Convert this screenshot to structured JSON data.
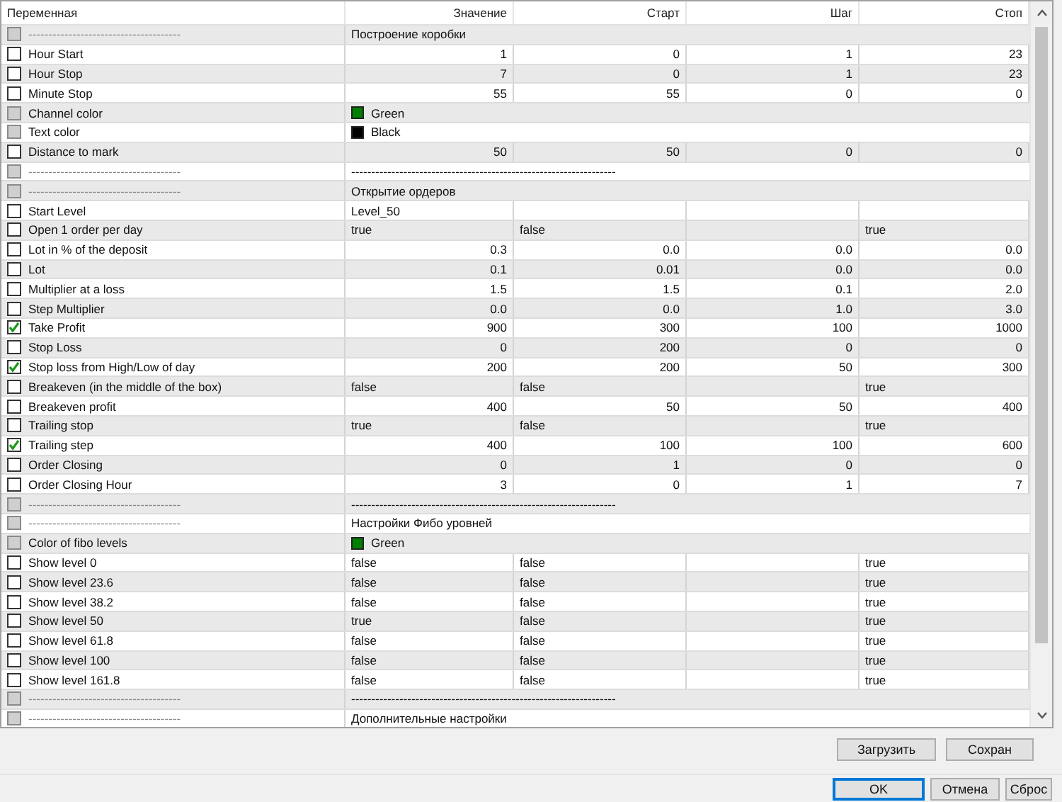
{
  "table": {
    "columns": [
      "Переменная",
      "Значение",
      "Старт",
      "Шаг",
      "Стоп"
    ],
    "rows": [
      {
        "kind": "section",
        "name": "--------------------------------------",
        "checked": false,
        "disabled": true,
        "value": "Построение коробки"
      },
      {
        "kind": "number",
        "name": "Hour Start",
        "checked": false,
        "disabled": false,
        "value": "1",
        "start": "0",
        "step": "1",
        "stop": "23"
      },
      {
        "kind": "number",
        "name": "Hour Stop",
        "checked": false,
        "disabled": false,
        "value": "7",
        "start": "0",
        "step": "1",
        "stop": "23"
      },
      {
        "kind": "number",
        "name": "Minute Stop",
        "checked": false,
        "disabled": false,
        "value": "55",
        "start": "55",
        "step": "0",
        "stop": "0"
      },
      {
        "kind": "color",
        "name": "Channel color",
        "checked": false,
        "disabled": true,
        "value": "Green",
        "color": "#008000"
      },
      {
        "kind": "color",
        "name": "Text color",
        "checked": false,
        "disabled": true,
        "value": "Black",
        "color": "#000000"
      },
      {
        "kind": "number",
        "name": "Distance to mark",
        "checked": false,
        "disabled": false,
        "value": "50",
        "start": "50",
        "step": "0",
        "stop": "0"
      },
      {
        "kind": "section",
        "name": "--------------------------------------",
        "checked": false,
        "disabled": true,
        "value": "------------------------------------------------------------------"
      },
      {
        "kind": "section",
        "name": "--------------------------------------",
        "checked": false,
        "disabled": true,
        "value": "Открытие ордеров"
      },
      {
        "kind": "text",
        "name": "Start Level",
        "checked": false,
        "disabled": false,
        "value": "Level_50"
      },
      {
        "kind": "bool",
        "name": "Open 1 order per day",
        "checked": false,
        "disabled": false,
        "value": "true",
        "start": "false",
        "stop": "true"
      },
      {
        "kind": "number",
        "name": "Lot in % of the deposit",
        "checked": false,
        "disabled": false,
        "value": "0.3",
        "start": "0.0",
        "step": "0.0",
        "stop": "0.0"
      },
      {
        "kind": "number",
        "name": "Lot",
        "checked": false,
        "disabled": false,
        "value": "0.1",
        "start": "0.01",
        "step": "0.0",
        "stop": "0.0"
      },
      {
        "kind": "number",
        "name": "Multiplier at a loss",
        "checked": false,
        "disabled": false,
        "value": "1.5",
        "start": "1.5",
        "step": "0.1",
        "stop": "2.0"
      },
      {
        "kind": "number",
        "name": "Step Multiplier",
        "checked": false,
        "disabled": false,
        "value": "0.0",
        "start": "0.0",
        "step": "1.0",
        "stop": "3.0"
      },
      {
        "kind": "number",
        "name": "Take Profit",
        "checked": true,
        "disabled": false,
        "value": "900",
        "start": "300",
        "step": "100",
        "stop": "1000"
      },
      {
        "kind": "number",
        "name": "Stop Loss",
        "checked": false,
        "disabled": false,
        "value": "0",
        "start": "200",
        "step": "0",
        "stop": "0"
      },
      {
        "kind": "number",
        "name": "Stop loss from High/Low of day",
        "checked": true,
        "disabled": false,
        "value": "200",
        "start": "200",
        "step": "50",
        "stop": "300"
      },
      {
        "kind": "bool",
        "name": "Breakeven (in the middle of the box)",
        "checked": false,
        "disabled": false,
        "value": "false",
        "start": "false",
        "stop": "true"
      },
      {
        "kind": "number",
        "name": "Breakeven profit",
        "checked": false,
        "disabled": false,
        "value": "400",
        "start": "50",
        "step": "50",
        "stop": "400"
      },
      {
        "kind": "bool",
        "name": "Trailing stop",
        "checked": false,
        "disabled": false,
        "value": "true",
        "start": "false",
        "stop": "true"
      },
      {
        "kind": "number",
        "name": "Trailing step",
        "checked": true,
        "disabled": false,
        "value": "400",
        "start": "100",
        "step": "100",
        "stop": "600"
      },
      {
        "kind": "number",
        "name": "Order Closing",
        "checked": false,
        "disabled": false,
        "value": "0",
        "start": "1",
        "step": "0",
        "stop": "0"
      },
      {
        "kind": "number",
        "name": "Order Closing Hour",
        "checked": false,
        "disabled": false,
        "value": "3",
        "start": "0",
        "step": "1",
        "stop": "7"
      },
      {
        "kind": "section",
        "name": "--------------------------------------",
        "checked": false,
        "disabled": true,
        "value": "------------------------------------------------------------------"
      },
      {
        "kind": "section",
        "name": "--------------------------------------",
        "checked": false,
        "disabled": true,
        "value": "Настройки Фибо уровней"
      },
      {
        "kind": "color",
        "name": "Color of fibo levels",
        "checked": false,
        "disabled": true,
        "value": "Green",
        "color": "#008000"
      },
      {
        "kind": "bool",
        "name": "Show level 0",
        "checked": false,
        "disabled": false,
        "value": "false",
        "start": "false",
        "stop": "true"
      },
      {
        "kind": "bool",
        "name": "Show level 23.6",
        "checked": false,
        "disabled": false,
        "value": "false",
        "start": "false",
        "stop": "true"
      },
      {
        "kind": "bool",
        "name": "Show level 38.2",
        "checked": false,
        "disabled": false,
        "value": "false",
        "start": "false",
        "stop": "true"
      },
      {
        "kind": "bool",
        "name": "Show level 50",
        "checked": false,
        "disabled": false,
        "value": "true",
        "start": "false",
        "stop": "true"
      },
      {
        "kind": "bool",
        "name": "Show level 61.8",
        "checked": false,
        "disabled": false,
        "value": "false",
        "start": "false",
        "stop": "true"
      },
      {
        "kind": "bool",
        "name": "Show level 100",
        "checked": false,
        "disabled": false,
        "value": "false",
        "start": "false",
        "stop": "true"
      },
      {
        "kind": "bool",
        "name": "Show level 161.8",
        "checked": false,
        "disabled": false,
        "value": "false",
        "start": "false",
        "stop": "true"
      },
      {
        "kind": "section",
        "name": "--------------------------------------",
        "checked": false,
        "disabled": true,
        "value": "------------------------------------------------------------------"
      },
      {
        "kind": "section",
        "name": "--------------------------------------",
        "checked": false,
        "disabled": true,
        "value": "Дополнительные настройки"
      }
    ]
  },
  "file_buttons": [
    {
      "label": "Загрузить",
      "default": false
    },
    {
      "label": "Сохран",
      "default": false
    }
  ],
  "dialog_buttons": [
    {
      "label": "OK",
      "default": true
    },
    {
      "label": "Отмена",
      "default": false
    },
    {
      "label": "Сброс",
      "default": false
    }
  ]
}
